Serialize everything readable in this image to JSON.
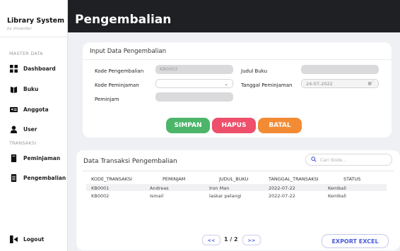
{
  "sidebar": {
    "brand_title": "Library System",
    "brand_subtitle": "by /muzufar/",
    "master_label": "MASTER DATA",
    "transaksi_label": "TRANSAKSI",
    "items": {
      "dashboard": "Dashboard",
      "buku": "Buku",
      "anggota": "Anggota",
      "user": "User",
      "peminjaman": "Peminjaman",
      "pengembalian": "Pengembalian",
      "logout": "Logout"
    }
  },
  "header": {
    "title": "Pengembalian"
  },
  "form": {
    "title": "Input Data Pengembalian",
    "kode_pengembalian_label": "Kode Pengembalian",
    "kode_pengembalian_value": "KB0003",
    "kode_peminjaman_label": "Kode Peminjaman",
    "kode_peminjaman_value": "",
    "peminjam_label": "Peminjam",
    "peminjam_value": "",
    "judul_buku_label": "Judul Buku",
    "judul_buku_value": "",
    "tanggal_label": "Tanggal Peminjaman",
    "tanggal_value": "24-07-2022"
  },
  "actions": {
    "simpan": "SIMPAN",
    "hapus": "HAPUS",
    "batal": "BATAL"
  },
  "table": {
    "title": "Data Transaksi Pengembalian",
    "search_placeholder": "Cari Kode...",
    "headers": [
      "KODE_TRANSAKSI",
      "PEMINJAM",
      "JUDUL_BUKU",
      "TANGGAL_TRANSAKSI",
      "STATUS"
    ],
    "rows": [
      [
        "KB0001",
        "Andreas",
        "Iron Man",
        "2022-07-22",
        "Kembali"
      ],
      [
        "KB0002",
        "Ismail",
        "laskar pelangi",
        "2022-07-22",
        "Kembali"
      ]
    ]
  },
  "pagination": {
    "prev": "<<",
    "page": "1 / 2",
    "next": ">>"
  },
  "export": "EXPORT EXCEL",
  "colors": {
    "header_bg": "#1f2024",
    "simpan": "#4cb56a",
    "hapus": "#ee4f6b",
    "batal": "#f38b35",
    "accent": "#4a5ad8"
  }
}
